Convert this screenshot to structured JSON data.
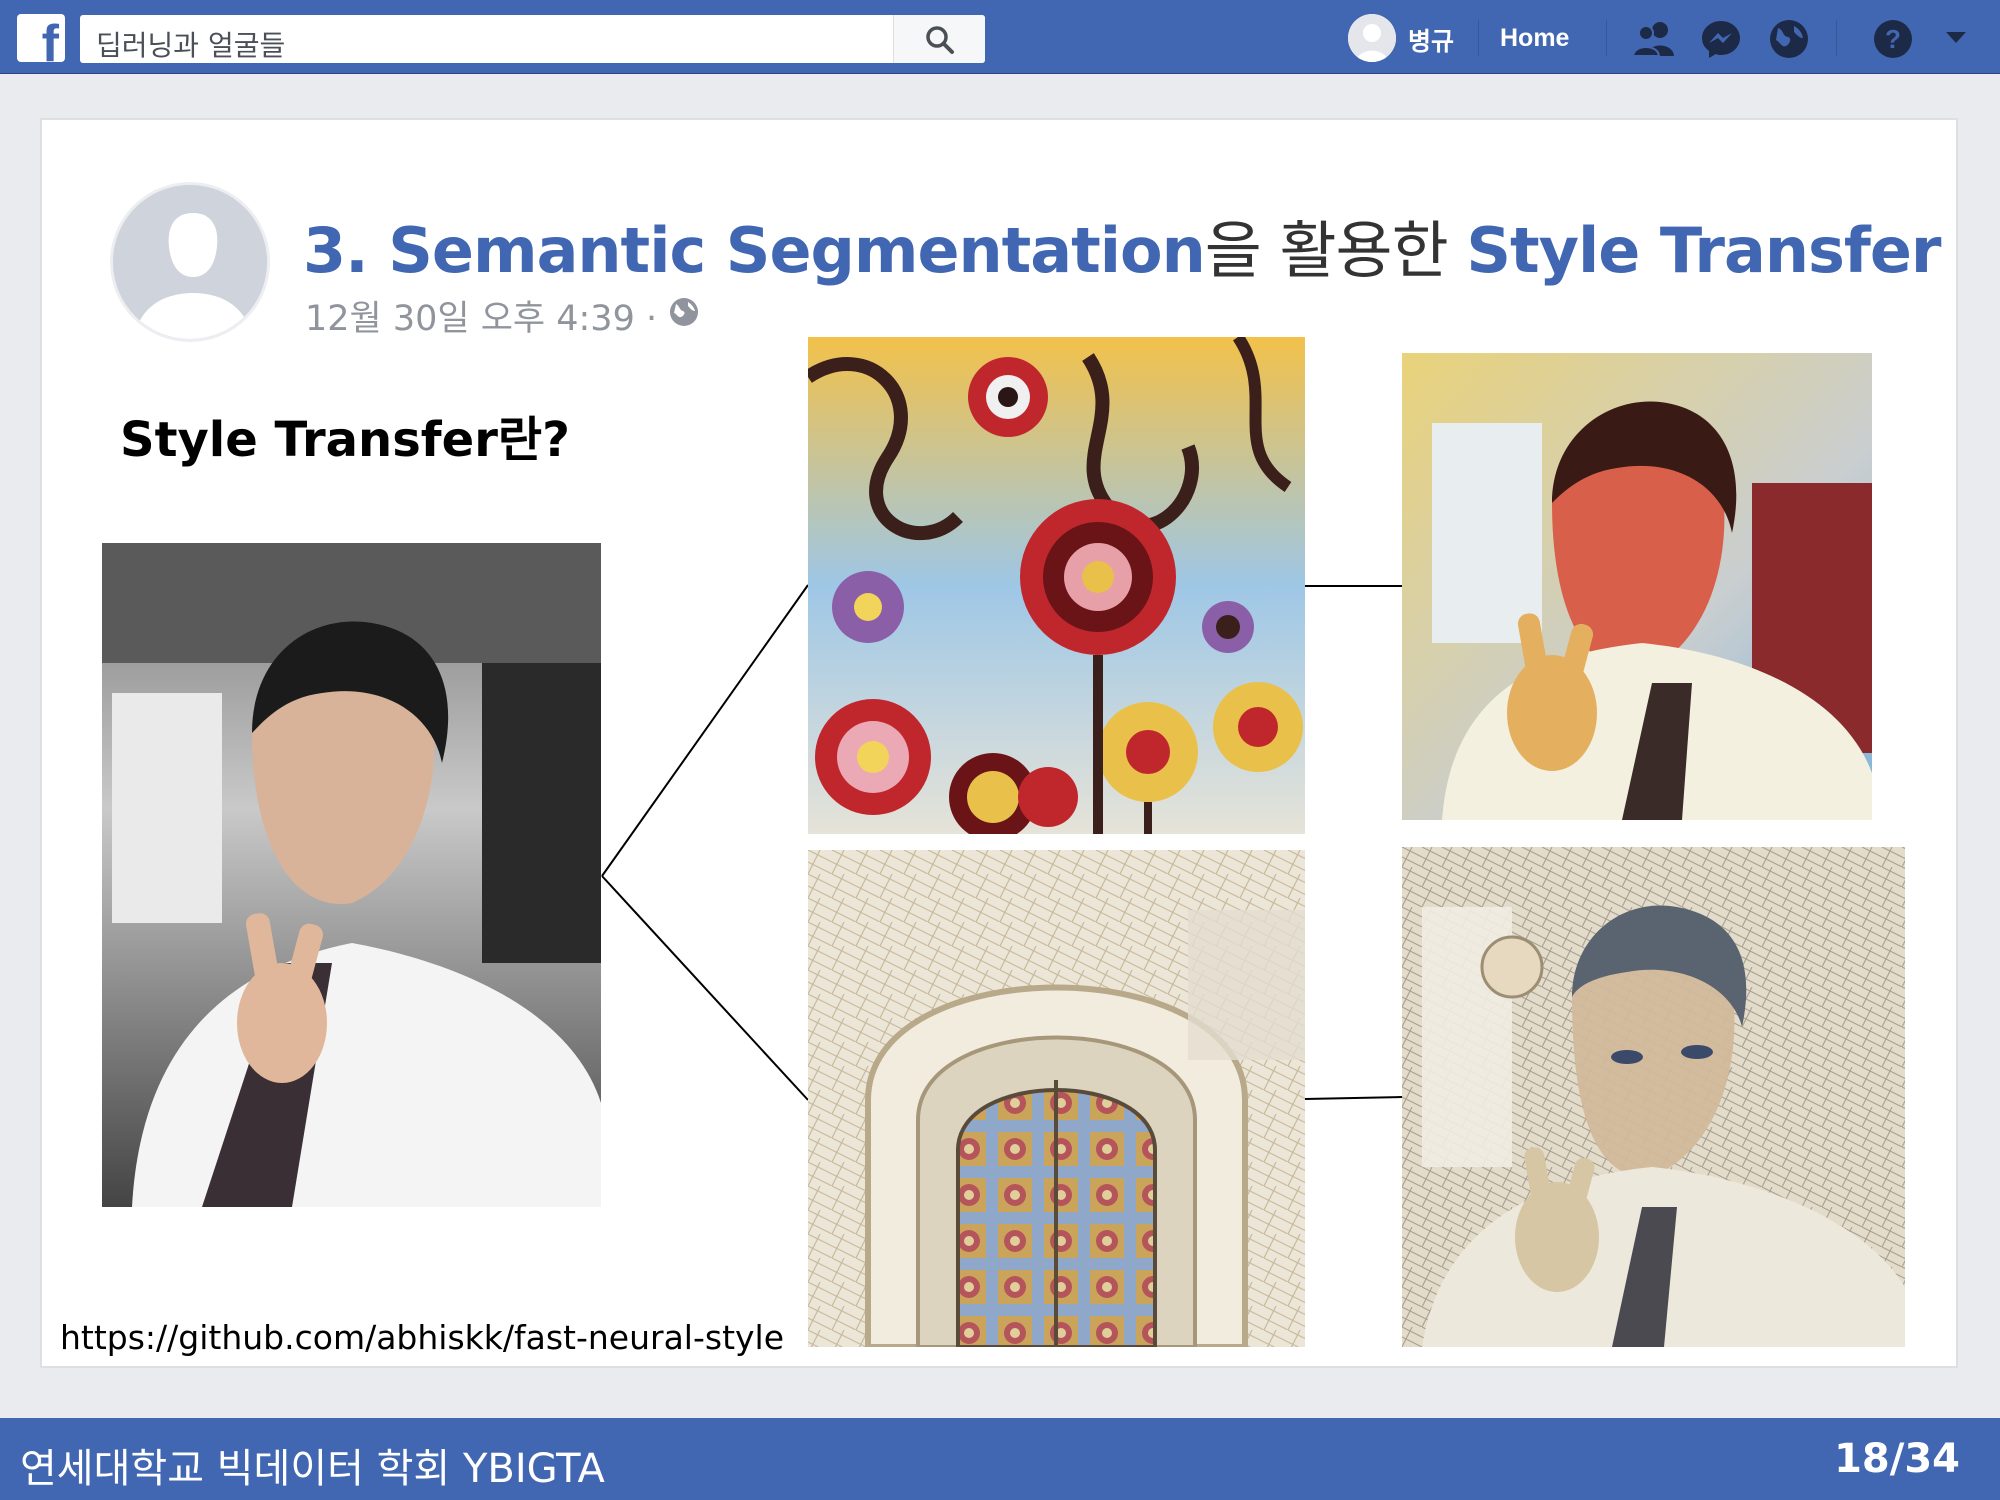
{
  "topbar": {
    "search_value": "딥러닝과 얼굴들",
    "user_name": "병규",
    "home_label": "Home"
  },
  "icons": {
    "logo": "facebook-logo",
    "search": "search-icon",
    "friends": "friends-icon",
    "messenger": "messenger-icon",
    "notifications": "globe-icon",
    "help": "help-icon",
    "menu": "chevron-down-icon"
  },
  "post": {
    "title_part1": "3. Semantic Segmentation",
    "title_part2": "을 활용한 ",
    "title_part3": "Style Transfer",
    "timestamp": "12월 30일 오후 4:39 · ",
    "subtitle": "Style Transfer란?",
    "link": "https://github.com/abhiskk/fast-neural-style"
  },
  "footer": {
    "organization": "연세대학교 빅데이터 학회 YBIGTA",
    "page": "18/34"
  },
  "colors": {
    "brand": "#4267b2",
    "title": "#4267b2",
    "timestamp": "#90949c",
    "background": "#e9ebee"
  }
}
